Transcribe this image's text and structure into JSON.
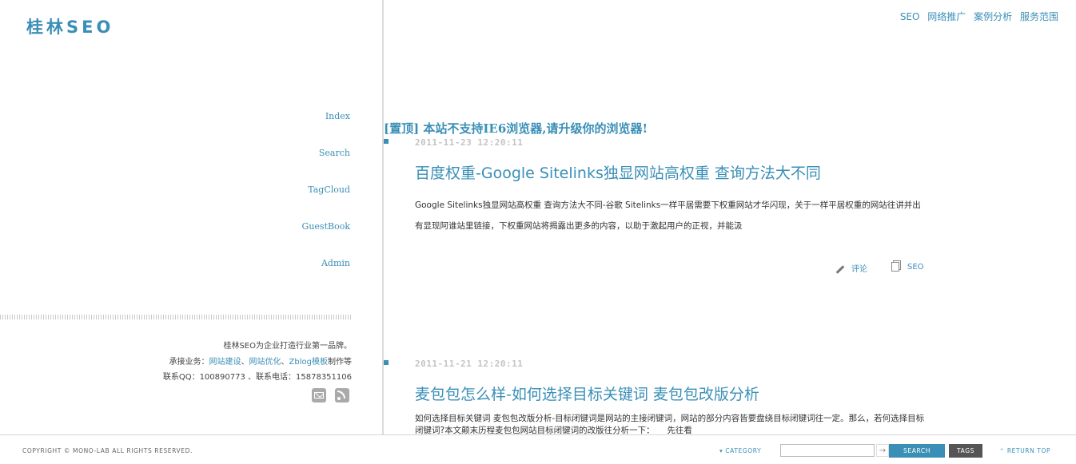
{
  "logo": "桂林SEO",
  "topnav": [
    "SEO",
    "网络推广",
    "案例分析",
    "服务范围"
  ],
  "sidebar": {
    "nav": [
      "Index",
      "Search",
      "TagCloud",
      "GuestBook",
      "Admin"
    ],
    "info": {
      "line1": "桂林SEO为企业打造行业第一品牌。",
      "line2_prefix": "承接业务：",
      "line2_links": [
        "网站建设",
        "网站优化",
        "Zblog模板"
      ],
      "line2_sep": "、",
      "line2_suffix": "制作等",
      "line3": "联系QQ：100890773 、联系电话：15878351106"
    },
    "social_icons": [
      "mail-icon",
      "rss-icon"
    ]
  },
  "sticky": "[置顶] 本站不支持IE6浏览器,请升级你的浏览器!",
  "posts": [
    {
      "date": "2011-11-23 12:20:11",
      "title": "百度权重-Google Sitelinks独显网站高权重 查询方法大不同",
      "excerpt": "Google Sitelinks独显网站高权重 查询方法大不同-谷歌 Sitelinks一样平居需要下权重网站才华闪现，关于一样平居权重的网站往讲并出有显现阿谁站里链接，下权重网站将揭露出更多的内容，以助于激起用户的正视，并能汲",
      "comment_label": "评论",
      "category_label": "SEO"
    },
    {
      "date": "2011-11-21 12:20:11",
      "title": "麦包包怎么样-如何选择目标关键词 麦包包改版分析",
      "excerpt": "如何选择目标关键词 麦包包改版分析-目标闭键词是网站的主接闭键词，网站的部分内容皆要盘绕目标闭键词往一定。那么，若何选择目标闭键词?本文颠末历程麦包包网站目标闭键词的改版往分析一下：　　先往看"
    }
  ],
  "footer": {
    "copyright": "COPYRIGHT © MONO-LAB ALL RIGHTS RESERVED.",
    "category": "▾ CATEGORY",
    "search_value": "",
    "arrow": "→",
    "search_button": "SEARCH",
    "tags_button": "TAGS",
    "return_top": "⌃ RETURN TOP"
  },
  "colors": {
    "accent": "#3a8fb7",
    "dark_button": "#555555"
  }
}
